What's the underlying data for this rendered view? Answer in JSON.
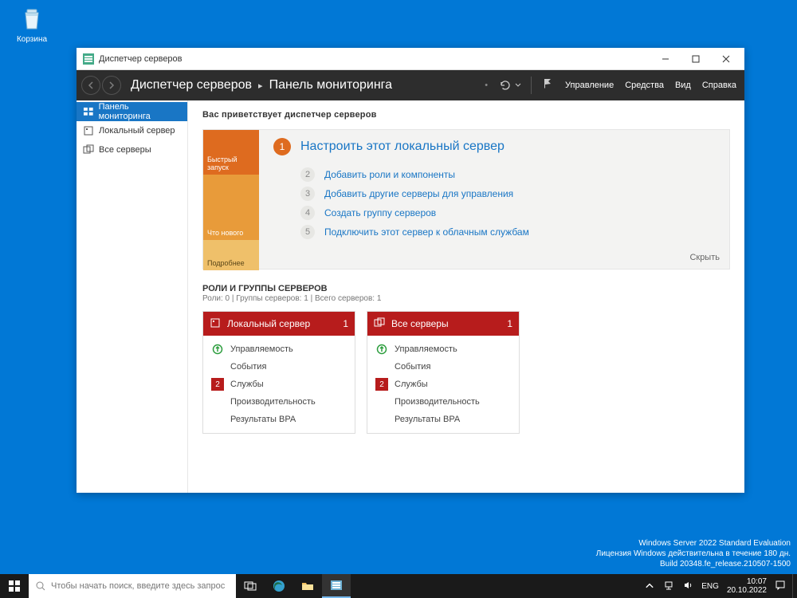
{
  "desktop": {
    "recycle_bin": "Корзина"
  },
  "watermark": {
    "line1": "Windows Server 2022 Standard Evaluation",
    "line2": "Лицензия Windows действительна в течение 180 дн.",
    "line3": "Build 20348.fe_release.210507-1500"
  },
  "window": {
    "title": "Диспетчер серверов",
    "breadcrumb_app": "Диспетчер серверов",
    "breadcrumb_page": "Панель мониторинга",
    "menu": {
      "manage": "Управление",
      "tools": "Средства",
      "view": "Вид",
      "help": "Справка"
    }
  },
  "sidebar": {
    "items": [
      {
        "label": "Панель мониторинга"
      },
      {
        "label": "Локальный сервер"
      },
      {
        "label": "Все серверы"
      }
    ]
  },
  "welcome": {
    "title": "Вас приветствует диспетчер серверов",
    "tabs": {
      "quick": "Быстрый запуск",
      "whatsnew": "Что нового",
      "details": "Подробнее"
    },
    "step1": "Настроить этот локальный сервер",
    "steps": [
      "Добавить роли и компоненты",
      "Добавить другие серверы для управления",
      "Создать группу серверов",
      "Подключить этот сервер к облачным службам"
    ],
    "hide": "Скрыть"
  },
  "roles": {
    "title": "РОЛИ И ГРУППЫ СЕРВЕРОВ",
    "subtitle": "Роли: 0 | Группы серверов: 1 | Всего серверов: 1",
    "tiles": [
      {
        "title": "Локальный сервер",
        "count": "1",
        "rows": {
          "manageability": "Управляемость",
          "events": "События",
          "services": "Службы",
          "services_badge": "2",
          "performance": "Производительность",
          "bpa": "Результаты BPA"
        }
      },
      {
        "title": "Все серверы",
        "count": "1",
        "rows": {
          "manageability": "Управляемость",
          "events": "События",
          "services": "Службы",
          "services_badge": "2",
          "performance": "Производительность",
          "bpa": "Результаты BPA"
        }
      }
    ]
  },
  "taskbar": {
    "search_placeholder": "Чтобы начать поиск, введите здесь запрос",
    "lang": "ENG",
    "time": "10:07",
    "date": "20.10.2022"
  }
}
